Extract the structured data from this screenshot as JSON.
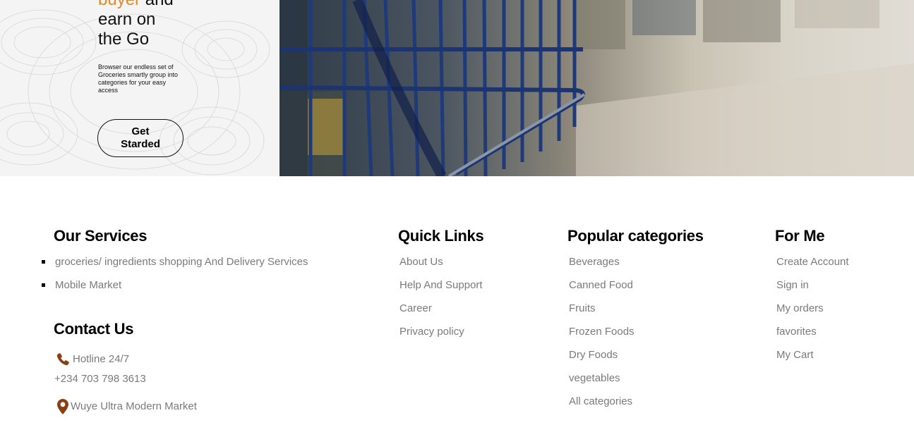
{
  "hero": {
    "headline_accent": "buyer",
    "headline_line1_rest": " and",
    "headline_line2": "earn on",
    "headline_line3": "the Go",
    "subtext": "Browser our endless set of Groceries smartly group into categories for your easy access",
    "cta_label": "Get Starded"
  },
  "colors": {
    "accent": "#e08a2c",
    "icon_brown": "#8a3f12",
    "link_gray": "#7a7a7a"
  },
  "footer": {
    "services": {
      "title": "Our Services",
      "items": [
        "groceries/ ingredients shopping And Delivery Services",
        "Mobile Market"
      ]
    },
    "contact": {
      "title": "Contact Us",
      "hotline_label": "Hotline 24/7",
      "phone": "+234 703 798 3613",
      "address": "Wuye Ultra Modern Market",
      "phone_icon": "phone-icon",
      "location_icon": "location-pin-icon"
    },
    "quick_links": {
      "title": "Quick Links",
      "items": [
        "About Us",
        "Help And Support",
        "Career",
        "Privacy policy"
      ]
    },
    "popular": {
      "title": "Popular categories",
      "items": [
        "Beverages",
        "Canned Food",
        "Fruits",
        "Frozen Foods",
        "Dry Foods",
        "vegetables",
        "All categories"
      ]
    },
    "for_me": {
      "title": "For Me",
      "items": [
        "Create Account",
        "Sign in",
        "My orders",
        "favorites",
        "My Cart"
      ]
    }
  }
}
